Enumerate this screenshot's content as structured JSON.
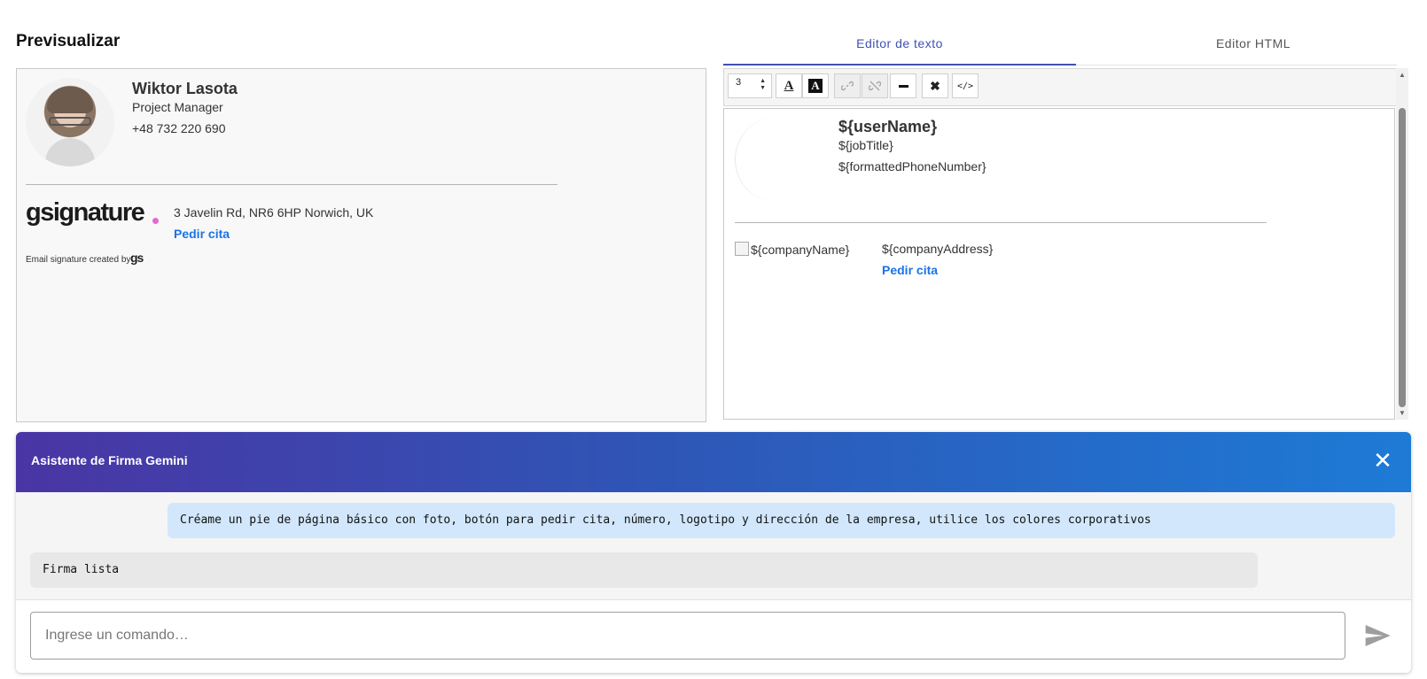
{
  "preview": {
    "title": "Previsualizar",
    "signature": {
      "name": "Wiktor Lasota",
      "job_title": "Project Manager",
      "phone": "+48 732 220 690",
      "logo_text": "gsignature",
      "address": "3 Javelin Rd, NR6 6HP Norwich, UK",
      "cta_label": "Pedir cita",
      "credit_text": "Email signature created by",
      "credit_logo": "gs"
    }
  },
  "tabs": [
    {
      "label": "Editor de texto",
      "active": true
    },
    {
      "label": "Editor HTML",
      "active": false
    }
  ],
  "toolbar": {
    "font_size": "3",
    "buttons": [
      {
        "name": "font-color",
        "icon": "A",
        "enabled": true
      },
      {
        "name": "background-color",
        "icon": "A",
        "enabled": true
      },
      {
        "name": "link",
        "icon": "link-icon",
        "enabled": false
      },
      {
        "name": "unlink",
        "icon": "unlink-icon",
        "enabled": false
      },
      {
        "name": "horizontal-rule",
        "icon": "minus-icon",
        "enabled": true
      },
      {
        "name": "remove-format",
        "icon": "x-icon",
        "enabled": true
      },
      {
        "name": "source-code",
        "icon": "code-icon",
        "enabled": true
      }
    ]
  },
  "editor": {
    "user_name": "${userName}",
    "job_title": "${jobTitle}",
    "phone": "${formattedPhoneNumber}",
    "company_name": "${companyName}",
    "company_address": "${companyAddress}",
    "cta_label": "Pedir cita"
  },
  "chat": {
    "title": "Asistente de Firma Gemini",
    "messages": [
      {
        "role": "user",
        "text": "Créame un pie de página básico con foto, botón para pedir cita, número, logotipo y dirección de la empresa, utilice los colores corporativos"
      },
      {
        "role": "assistant",
        "text": "Firma lista"
      }
    ],
    "input_placeholder": "Ingrese un comando…",
    "input_value": ""
  },
  "colors": {
    "accent": "#3f51b5",
    "link": "#1a73e8",
    "header_gradient_start": "#4a35a4",
    "header_gradient_end": "#1d7bd6",
    "user_bubble": "#d2e7fb",
    "bot_bubble": "#e8e8e8"
  }
}
